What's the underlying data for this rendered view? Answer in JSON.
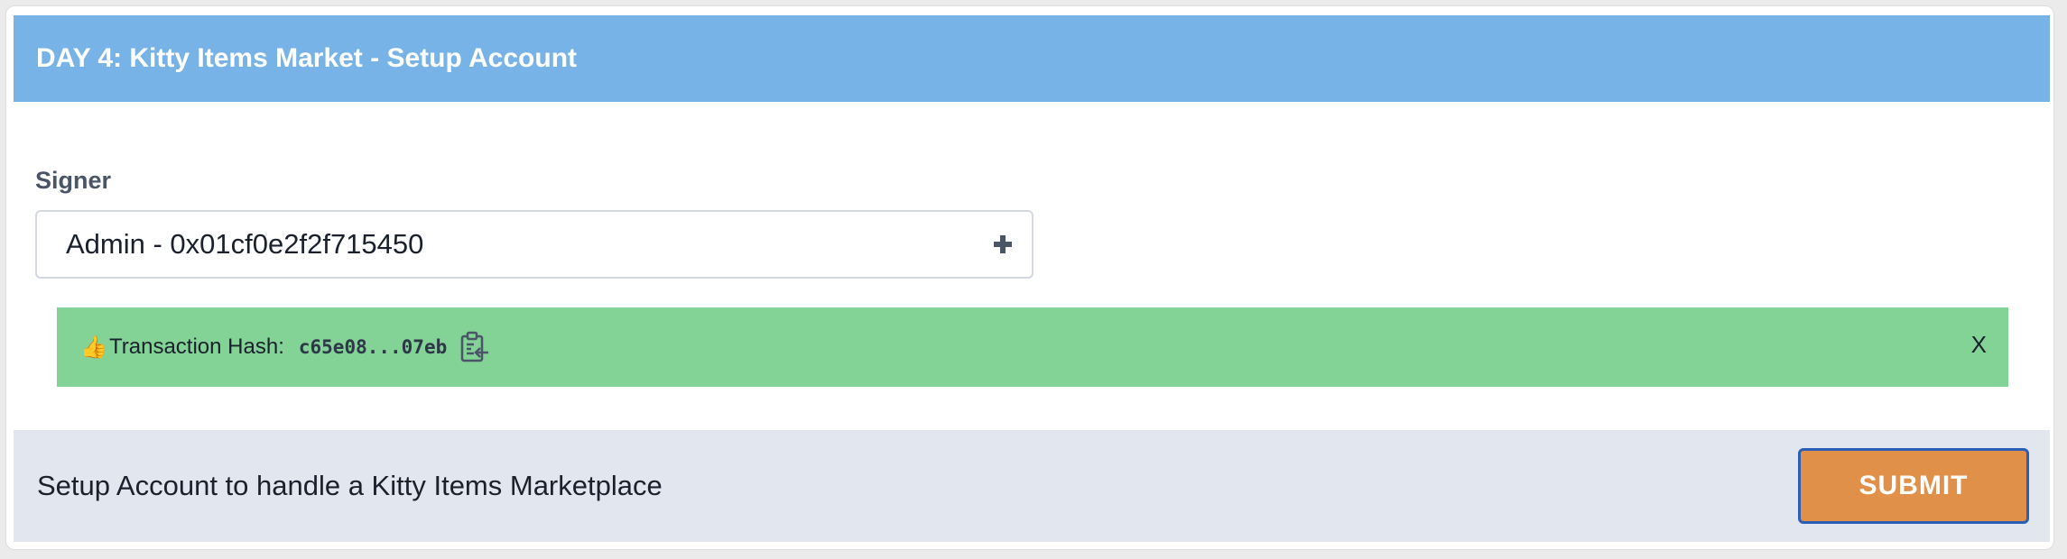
{
  "header": {
    "title": "DAY 4: Kitty Items Market - Setup Account"
  },
  "signer": {
    "label": "Signer",
    "value": "Admin - 0x01cf0e2f2f715450"
  },
  "alert": {
    "icon": "thumbs-up-icon",
    "label": "Transaction Hash:",
    "hash": "c65e08...07eb",
    "close_label": "X"
  },
  "footer": {
    "description": "Setup Account to handle a Kitty Items Marketplace",
    "submit_label": "SUBMIT"
  },
  "colors": {
    "header_bg": "#78b3e8",
    "alert_bg": "#83d296",
    "footer_bg": "#e2e6ee",
    "submit_bg": "#e09048",
    "submit_border": "#2b5fb5"
  }
}
